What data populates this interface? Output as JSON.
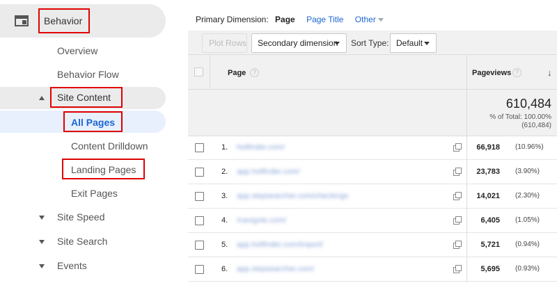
{
  "sidebar": {
    "header_label": "Behavior",
    "items": {
      "overview": "Overview",
      "behavior_flow": "Behavior Flow",
      "site_content": "Site Content",
      "all_pages": "All Pages",
      "content_drilldown": "Content Drilldown",
      "landing_pages": "Landing Pages",
      "exit_pages": "Exit Pages",
      "site_speed": "Site Speed",
      "site_search": "Site Search",
      "events": "Events"
    },
    "active_color": "#1a67d2",
    "highlight_color": "#e00000"
  },
  "primary_dimension": {
    "label": "Primary Dimension:",
    "active": "Page",
    "option_page_title": "Page Title",
    "option_other": "Other"
  },
  "toolbar": {
    "plot_rows": "Plot Rows",
    "secondary_dimension": "Secondary dimension",
    "sort_type_label": "Sort Type:",
    "sort_type_value": "Default"
  },
  "table": {
    "col_page": "Page",
    "col_pageviews": "Pageviews",
    "help_glyph": "?",
    "sort_glyph": "↓",
    "total_value": "610,484",
    "total_pct_line": "% of Total: 100.00%",
    "total_abs_line": "(610,484)",
    "rows": [
      {
        "num": "1.",
        "url": "hotfinder.com/",
        "value": "66,918",
        "pct": "(10.96%)"
      },
      {
        "num": "2.",
        "url": "app.hotfinder.com/",
        "value": "23,783",
        "pct": "(3.90%)"
      },
      {
        "num": "3.",
        "url": "app.stepsearcher.com/checkings",
        "value": "14,021",
        "pct": "(2.30%)"
      },
      {
        "num": "4.",
        "url": "/navigvte.com/",
        "value": "6,405",
        "pct": "(1.05%)"
      },
      {
        "num": "5.",
        "url": "app.hotfinder.com/import/",
        "value": "5,721",
        "pct": "(0.94%)"
      },
      {
        "num": "6.",
        "url": "app.stepsearcher.com/",
        "value": "5,695",
        "pct": "(0.93%)"
      }
    ]
  }
}
